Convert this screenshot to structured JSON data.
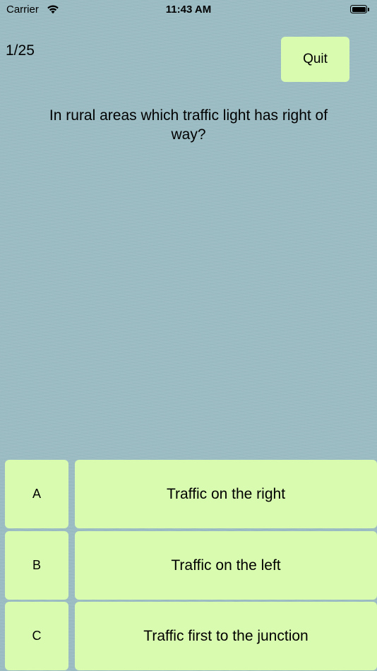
{
  "status_bar": {
    "carrier": "Carrier",
    "time": "11:43 AM",
    "wifi_icon": "wifi-icon",
    "battery_icon": "battery-icon"
  },
  "header": {
    "progress": "1/25",
    "quit_label": "Quit"
  },
  "question": {
    "text": "In rural areas which traffic light has right of way?"
  },
  "answers": [
    {
      "letter": "A",
      "text": "Traffic on the right"
    },
    {
      "letter": "B",
      "text": "Traffic on the left"
    },
    {
      "letter": "C",
      "text": "Traffic first to the junction"
    }
  ],
  "colors": {
    "background": "#9cbcc4",
    "button": "#d9fbb0"
  }
}
